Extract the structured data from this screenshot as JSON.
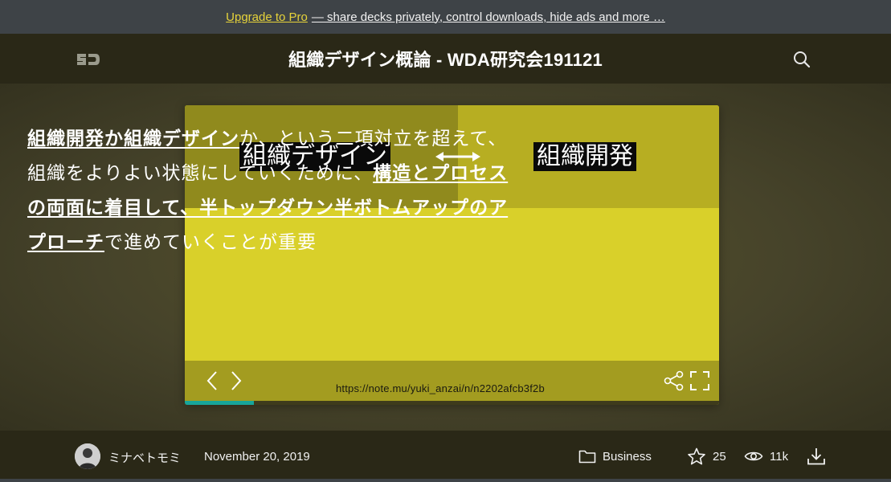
{
  "promo": {
    "link_label": "Upgrade to Pro",
    "rest_text": "— share decks privately, control downloads, hide ads and more …"
  },
  "header": {
    "logo_icon": "speakerdeck-logo-icon",
    "title": "組織デザイン概論 - WDA研究会191121",
    "search_icon": "search-icon"
  },
  "slide": {
    "term_left": "組織デザイン",
    "term_right": "組織開発",
    "arrow_icon": "double-arrow-icon",
    "body_segments": [
      {
        "text": "組織開発か組織デザイン",
        "em": true
      },
      {
        "text": "か、という二項対立を超えて、組織をよりよい状態にしていくために、",
        "em": false
      },
      {
        "text": "構造とプロセスの両面に着目して、半トップダウン半ボトムアップのアプローチ",
        "em": true
      },
      {
        "text": "で進めていくことが重要",
        "em": false
      }
    ],
    "url": "https://note.mu/yuki_anzai/n/n2202afcb3f2b",
    "progress": 0.13,
    "colors": {
      "top_left": "#908a1d",
      "top_right": "#b7ae22",
      "body": "#d9d02a",
      "controls": "#a39c20",
      "progress": "#17a59a"
    }
  },
  "controls": {
    "prev_icon": "chevron-left-icon",
    "next_icon": "chevron-right-icon",
    "share_icon": "share-icon",
    "fullscreen_icon": "fullscreen-icon"
  },
  "footer": {
    "author": "ミナベトモミ",
    "date": "November 20, 2019",
    "category": "Business",
    "stars": "25",
    "views": "11k",
    "avatar_icon": "avatar",
    "folder_icon": "folder-icon",
    "star_icon": "star-icon",
    "eye_icon": "eye-icon",
    "download_icon": "download-icon"
  }
}
